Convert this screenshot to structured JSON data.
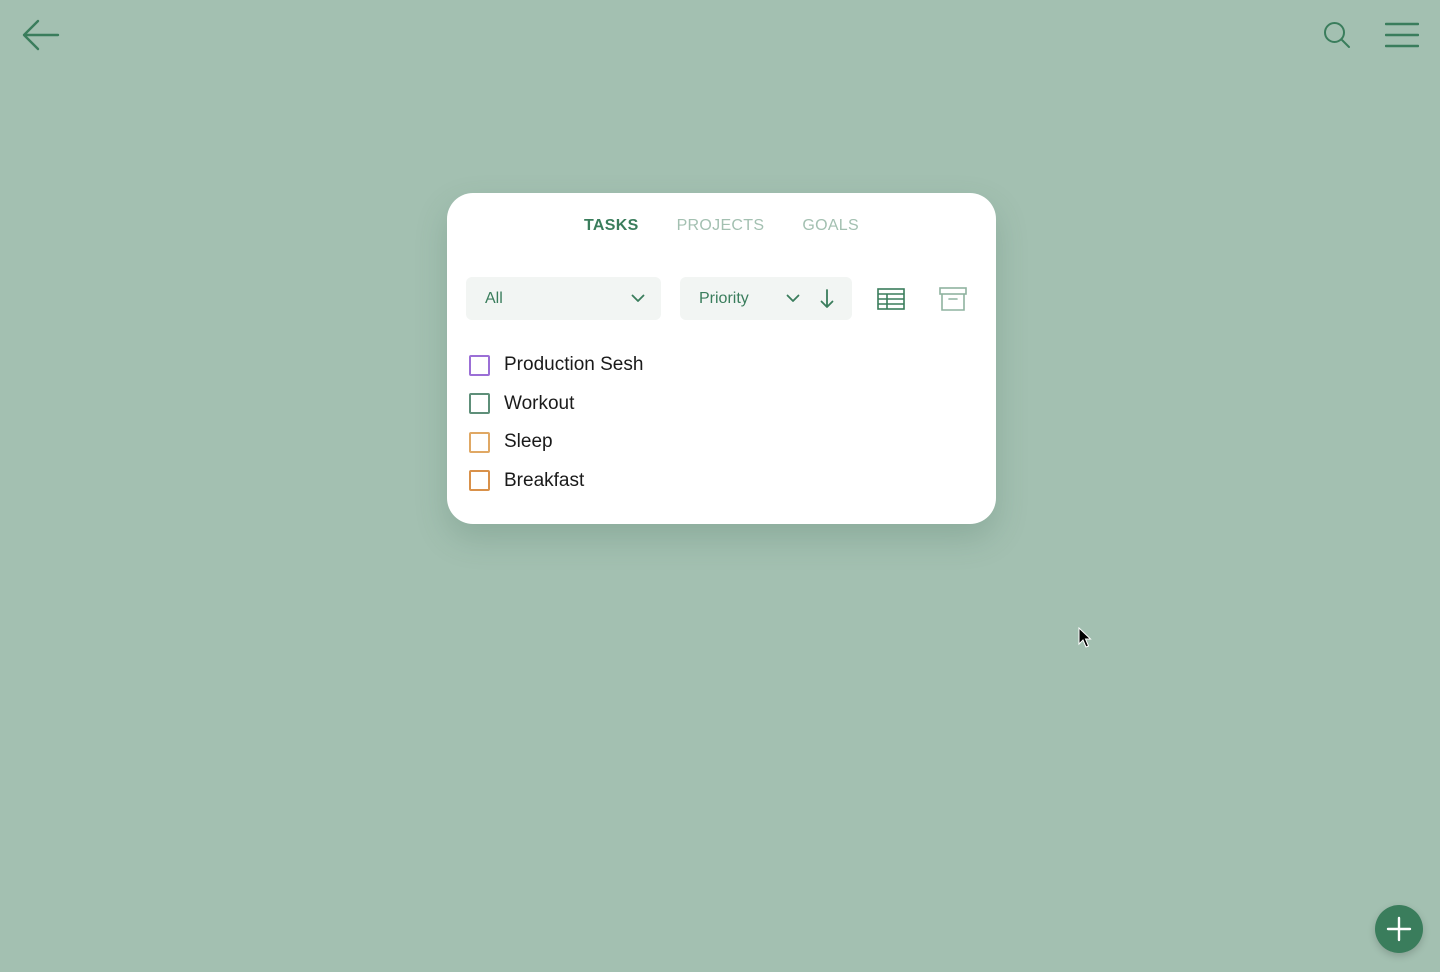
{
  "nav": {
    "back_icon": "arrow-left-icon",
    "search_icon": "search-icon",
    "menu_icon": "hamburger-icon"
  },
  "tabs": [
    {
      "label": "TASKS",
      "active": true
    },
    {
      "label": "PROJECTS",
      "active": false
    },
    {
      "label": "GOALS",
      "active": false
    }
  ],
  "filter": {
    "selected": "All"
  },
  "sort": {
    "selected": "Priority",
    "direction": "descending"
  },
  "tasks": [
    {
      "label": "Production Sesh",
      "color": "#9b6fd6",
      "checked": false
    },
    {
      "label": "Workout",
      "color": "#5e8f79",
      "checked": false
    },
    {
      "label": "Sleep",
      "color": "#e0a864",
      "checked": false
    },
    {
      "label": "Breakfast",
      "color": "#d9914a",
      "checked": false
    }
  ],
  "colors": {
    "background": "#a3c0b1",
    "accent": "#3a7d5c",
    "inactive_tab": "#a3c0b1"
  },
  "fab_icon": "plus-icon"
}
